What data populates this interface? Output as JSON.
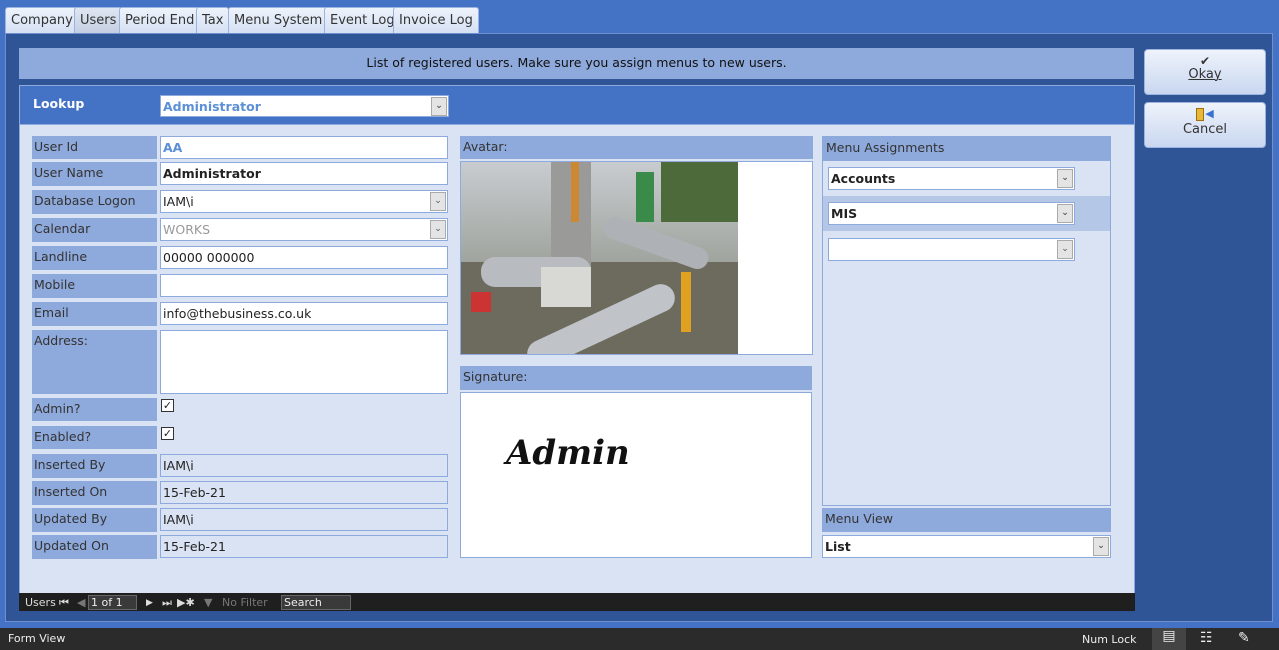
{
  "tabs": [
    "Company",
    "Users",
    "Period End",
    "Tax",
    "Menu System",
    "Event Log",
    "Invoice Log"
  ],
  "active_tab": "Users",
  "banner": "List of registered users. Make sure you assign menus to new users.",
  "lookup": {
    "label": "Lookup",
    "value": "Administrator"
  },
  "fields": {
    "user_id": {
      "label": "User Id",
      "value": "AA"
    },
    "user_name": {
      "label": "User Name",
      "value": "Administrator"
    },
    "db_logon": {
      "label": "Database Logon",
      "value": "IAM\\i"
    },
    "calendar": {
      "label": "Calendar",
      "value": "WORKS"
    },
    "landline": {
      "label": "Landline",
      "value": "00000 000000"
    },
    "mobile": {
      "label": "Mobile",
      "value": ""
    },
    "email": {
      "label": "Email",
      "value": "info@thebusiness.co.uk"
    },
    "address": {
      "label": "Address:",
      "value": ""
    },
    "admin": {
      "label": "Admin?",
      "checked": true
    },
    "enabled": {
      "label": "Enabled?",
      "checked": true
    },
    "inserted_by": {
      "label": "Inserted By",
      "value": "IAM\\i"
    },
    "inserted_on": {
      "label": "Inserted On",
      "value": "15-Feb-21"
    },
    "updated_by": {
      "label": "Updated By",
      "value": "IAM\\i"
    },
    "updated_on": {
      "label": "Updated On",
      "value": "15-Feb-21"
    }
  },
  "avatar_label": "Avatar:",
  "signature_label": "Signature:",
  "signature_text": "Admin",
  "menu_assignments": {
    "label": "Menu Assignments",
    "items": [
      "Accounts",
      "MIS",
      ""
    ]
  },
  "menu_view": {
    "label": "Menu View",
    "value": "List"
  },
  "buttons": {
    "okay": "Okay",
    "cancel": "Cancel"
  },
  "navbar": {
    "record_label": "Users",
    "position": "1 of 1",
    "filter": "No Filter",
    "search": "Search"
  },
  "status": {
    "left": "Form View",
    "num_lock": "Num Lock"
  }
}
